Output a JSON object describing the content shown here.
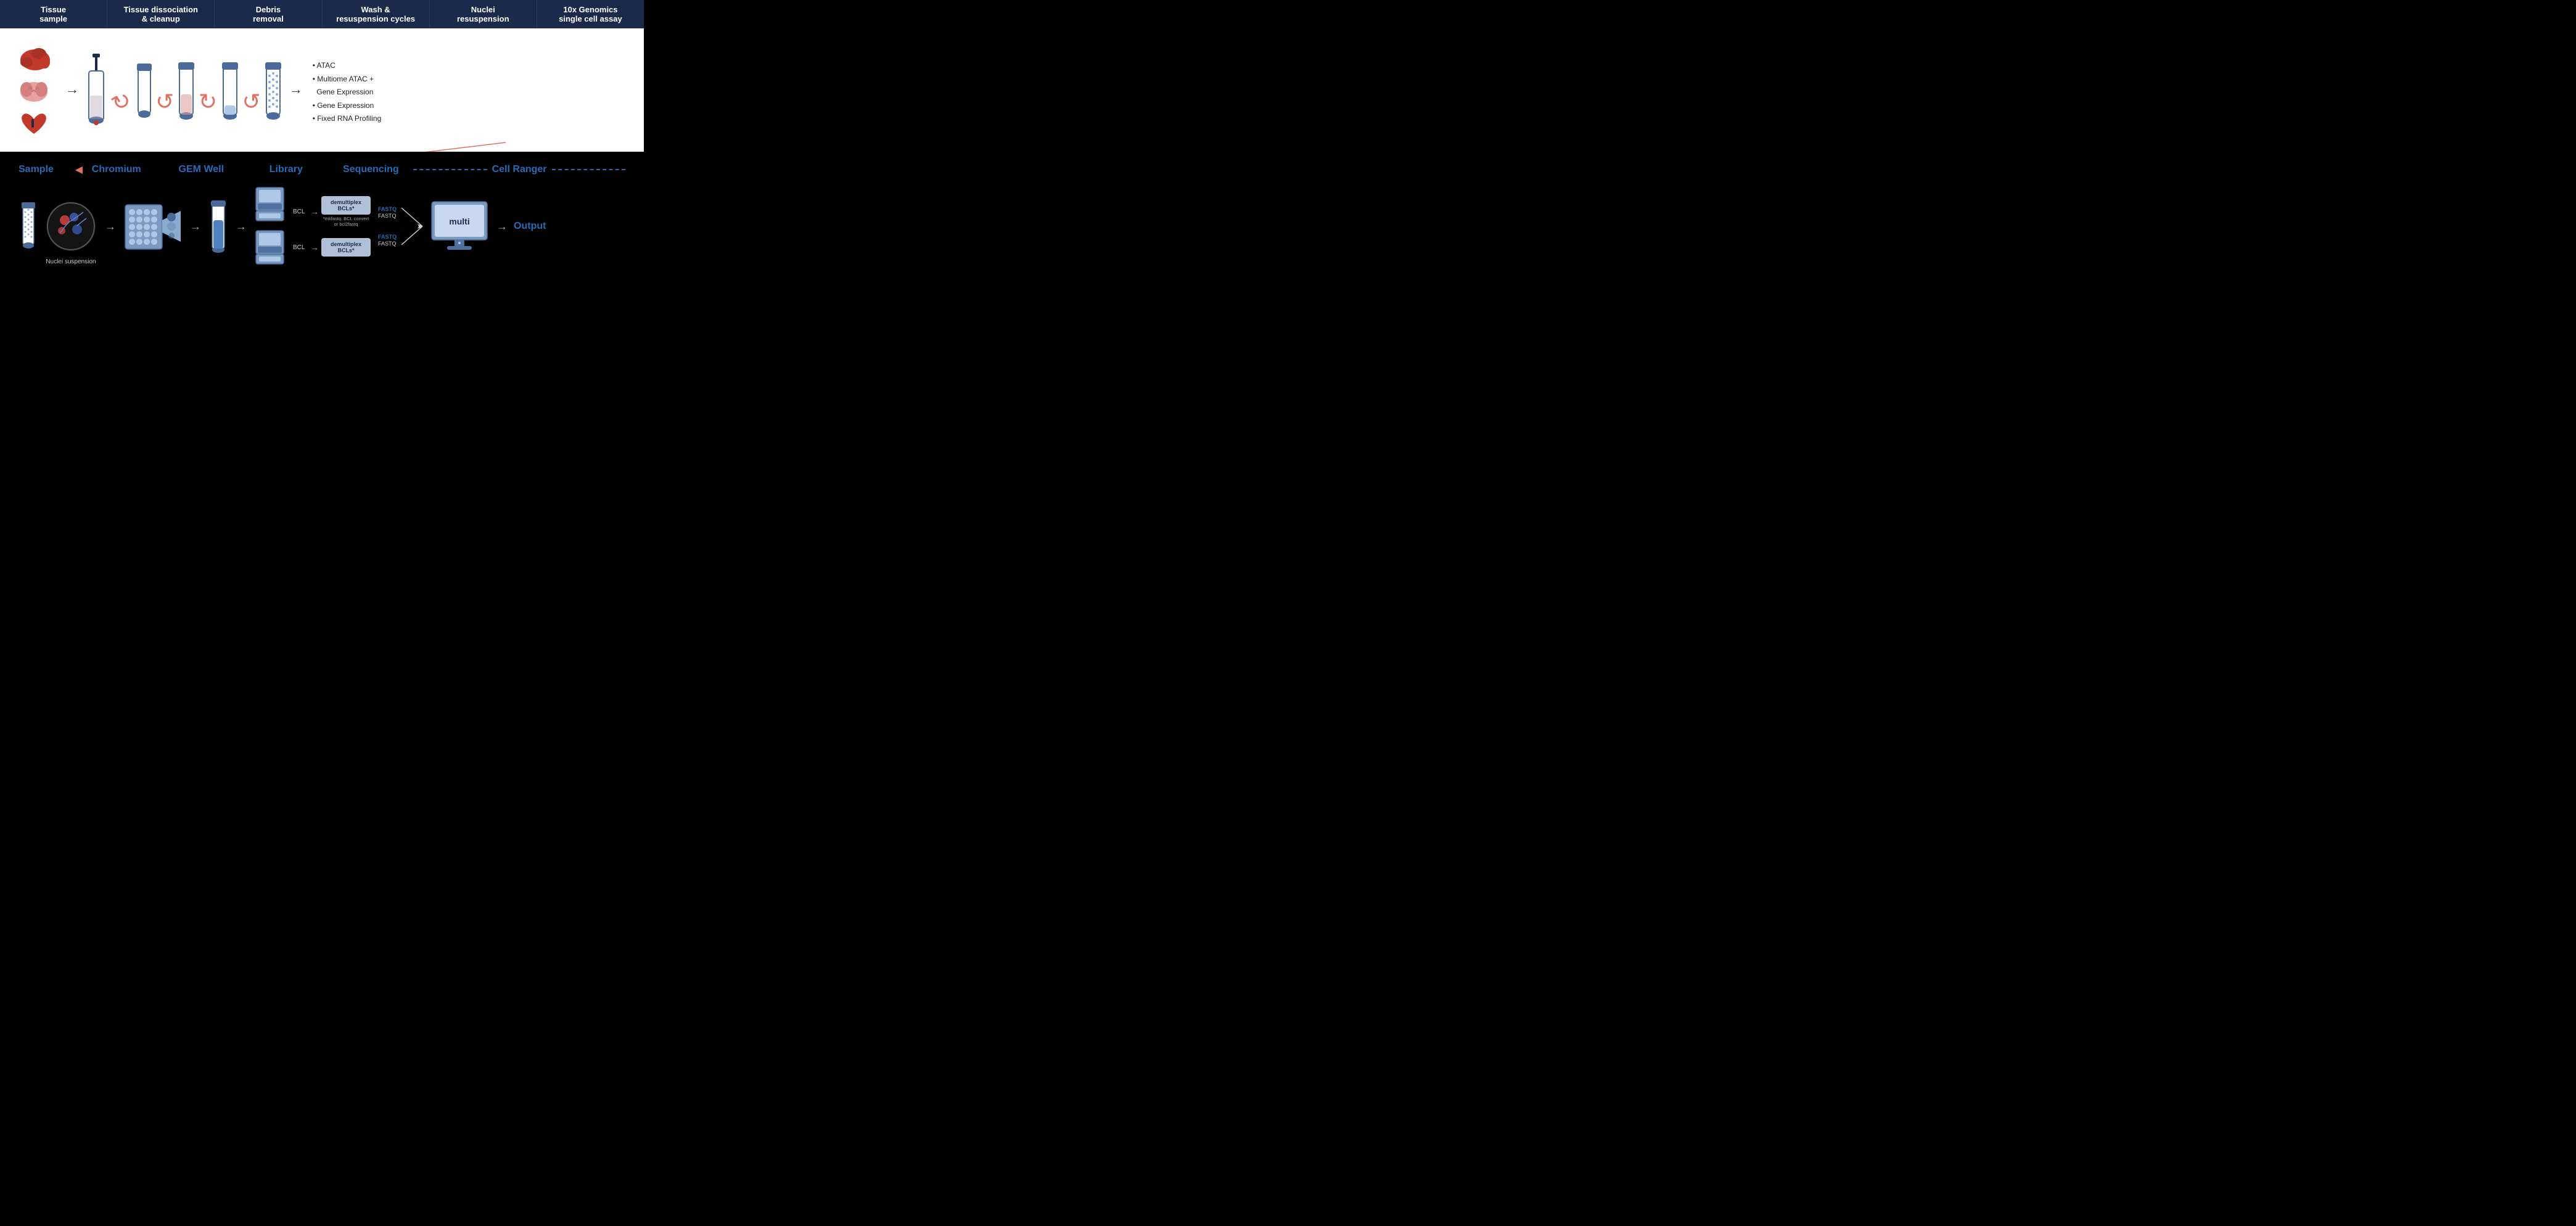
{
  "header": {
    "cols": [
      "Tissue\nsample",
      "Tissue dissociation\n& cleanup",
      "Debris\nremoval",
      "Wash &\nresuspension cycles",
      "Nuclei\nresuspension",
      "10x Genomics\nsingle cell assay"
    ]
  },
  "assays": [
    "• ATAC",
    "• Multiome ATAC +\n  Gene Expression",
    "• Gene Expression",
    "• Fixed RNA Profiling"
  ],
  "pipeline": {
    "labels": {
      "sample": "Sample",
      "chromium": "Chromium",
      "gem_well": "GEM Well",
      "library": "Library",
      "sequencing": "Sequencing",
      "cell_ranger": "Cell Ranger"
    },
    "bcl_labels": [
      "BCL",
      "BCL"
    ],
    "demux_label": "demultiplex\nBCLs*",
    "demux_note": "*mkfastq, BCL convert\nor bcl2fastq",
    "fastq_bold": "FASTQ",
    "fastq_normal": "FASTQ",
    "multi_label": "multi",
    "output_label": "Output"
  },
  "nuclei_label": "Nuclei\nsuspension",
  "colors": {
    "dark_blue": "#1a2a4a",
    "mid_blue": "#2a6ab5",
    "light_blue": "#7a9abf",
    "red_arrow": "#e07060",
    "demux_bg": "#b0c0d8"
  }
}
